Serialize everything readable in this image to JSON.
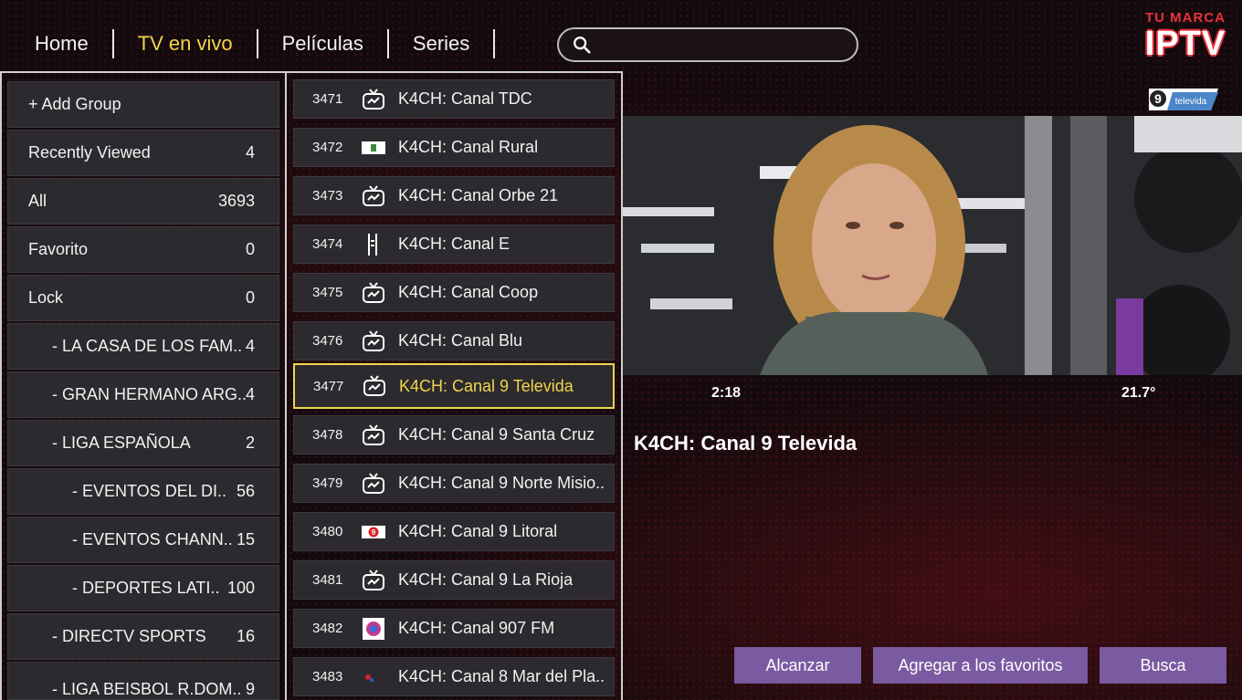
{
  "nav": {
    "items": [
      {
        "label": "Home",
        "active": false
      },
      {
        "label": "TV en vivo",
        "active": true
      },
      {
        "label": "Películas",
        "active": false
      },
      {
        "label": "Series",
        "active": false
      }
    ]
  },
  "search": {
    "value": "",
    "placeholder": ""
  },
  "brand": {
    "top": "TU MARCA",
    "main": "IPTV"
  },
  "groups": [
    {
      "label": "+ Add Group",
      "count": ""
    },
    {
      "label": "Recently Viewed",
      "count": "4"
    },
    {
      "label": "All",
      "count": "3693"
    },
    {
      "label": "Favorito",
      "count": "0"
    },
    {
      "label": "Lock",
      "count": "0"
    },
    {
      "label": "- LA CASA DE LOS FAM..",
      "count": "4"
    },
    {
      "label": "- GRAN HERMANO ARG..",
      "count": "4"
    },
    {
      "label": "- LIGA ESPAÑOLA",
      "count": "2"
    },
    {
      "label": "- EVENTOS DEL DI..",
      "count": "56"
    },
    {
      "label": "- EVENTOS CHANN..",
      "count": "15"
    },
    {
      "label": "- DEPORTES LATI..",
      "count": "100"
    },
    {
      "label": "- DIRECTV SPORTS",
      "count": "16"
    },
    {
      "label": "- LIGA BEISBOL R.DOM..",
      "count": "9"
    }
  ],
  "channels": [
    {
      "num": "3471",
      "name": "K4CH: Canal TDC",
      "icon": "tv-icon"
    },
    {
      "num": "3472",
      "name": "K4CH: Canal Rural",
      "icon": "canal-rural-logo"
    },
    {
      "num": "3473",
      "name": "K4CH: Canal Orbe 21",
      "icon": "tv-icon"
    },
    {
      "num": "3474",
      "name": "K4CH: Canal E",
      "icon": "canal-e-logo"
    },
    {
      "num": "3475",
      "name": "K4CH: Canal Coop",
      "icon": "tv-icon"
    },
    {
      "num": "3476",
      "name": "K4CH: Canal Blu",
      "icon": "tv-icon"
    },
    {
      "num": "3477",
      "name": "K4CH: Canal 9 Televida",
      "icon": "tv-icon",
      "selected": true
    },
    {
      "num": "3478",
      "name": "K4CH: Canal 9 Santa Cruz",
      "icon": "tv-icon"
    },
    {
      "num": "3479",
      "name": "K4CH: Canal 9 Norte Misio..",
      "icon": "tv-icon"
    },
    {
      "num": "3480",
      "name": "K4CH: Canal 9 Litoral",
      "icon": "canal-9-litoral-logo"
    },
    {
      "num": "3481",
      "name": "K4CH: Canal 9 La Rioja",
      "icon": "tv-icon"
    },
    {
      "num": "3482",
      "name": "K4CH: Canal 907 FM",
      "icon": "fm-907-logo"
    },
    {
      "num": "3483",
      "name": "K4CH: Canal 8 Mar del Pla..",
      "icon": "canal-8-logo"
    }
  ],
  "player": {
    "channel_logo_text": "televida",
    "time": "2:18",
    "temperature": "21.7°",
    "now_title": "K4CH: Canal 9 Televida"
  },
  "buttons": {
    "reach": "Alcanzar",
    "add_favorites": "Agregar a los favoritos",
    "search": "Busca"
  },
  "colors": {
    "accent": "#f1d54a",
    "button": "#7a5aa0",
    "brand_red": "#e8323c"
  }
}
